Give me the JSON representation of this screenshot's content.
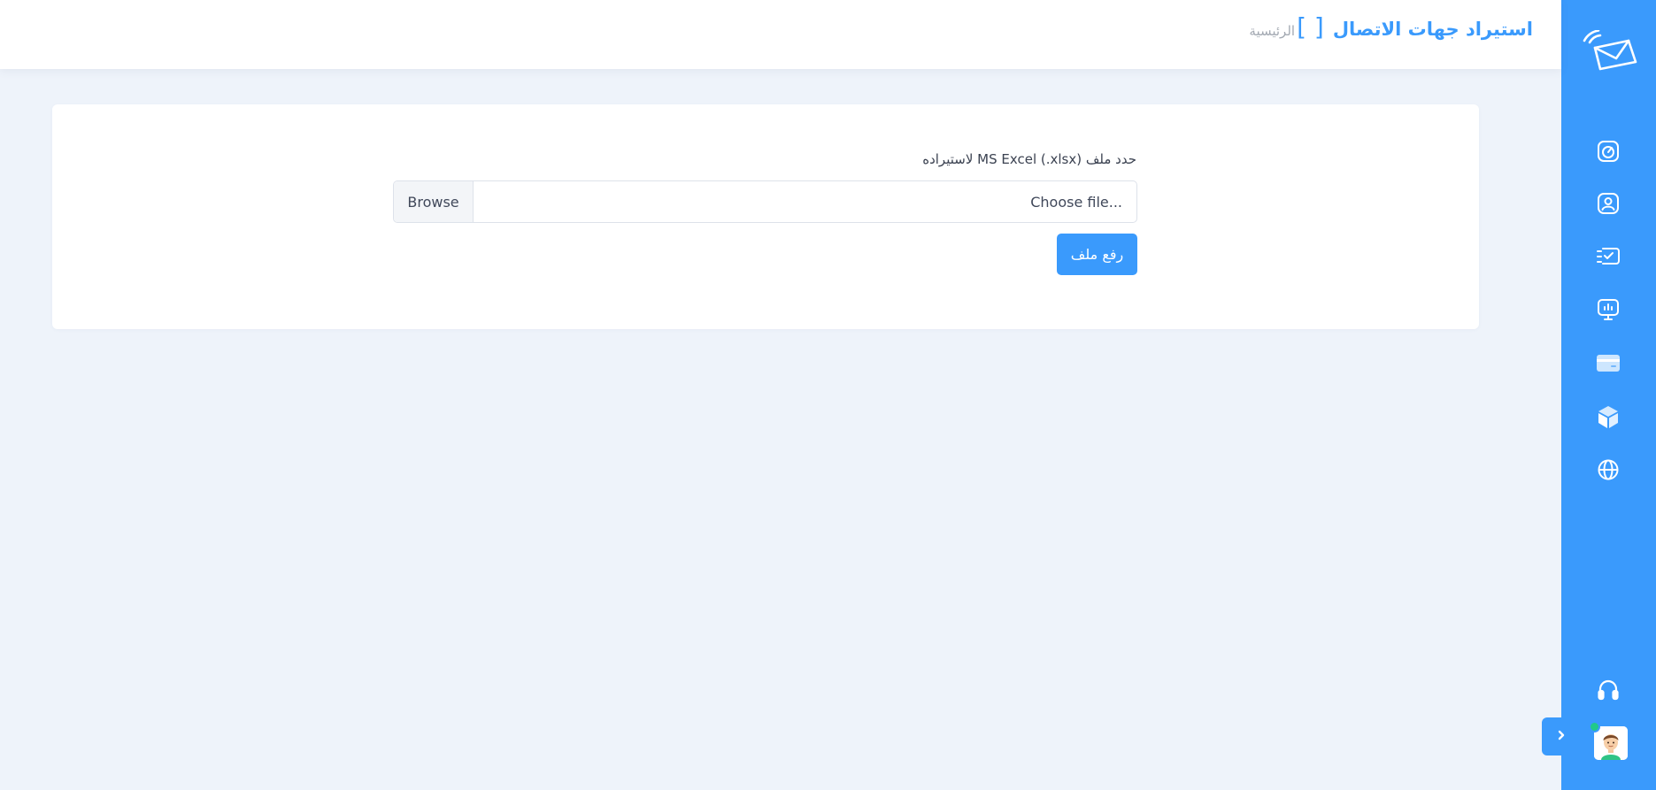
{
  "header": {
    "title": "استيراد جهات الاتصال",
    "title_bracket": "[ ]",
    "breadcrumb": "الرئيسية"
  },
  "form": {
    "label": "حدد ملف MS Excel (.xlsx) لاستيراده",
    "file_placeholder": "Choose file...",
    "browse_label": "Browse",
    "upload_label": "رفع ملف"
  },
  "sidebar": {
    "logo_icon": "envelope-signal-icon",
    "items": [
      {
        "icon": "dashboard-gauge-icon"
      },
      {
        "icon": "contact-card-icon"
      },
      {
        "icon": "campaign-message-icon"
      },
      {
        "icon": "presentation-chart-icon"
      },
      {
        "icon": "credit-card-icon"
      },
      {
        "icon": "package-box-icon"
      },
      {
        "icon": "globe-icon"
      }
    ],
    "support_icon": "headphones-icon",
    "toggle_icon": "chevron-right-icon"
  },
  "colors": {
    "primary": "#3a9afc",
    "background": "#eef3fa",
    "online": "#21c98a"
  }
}
